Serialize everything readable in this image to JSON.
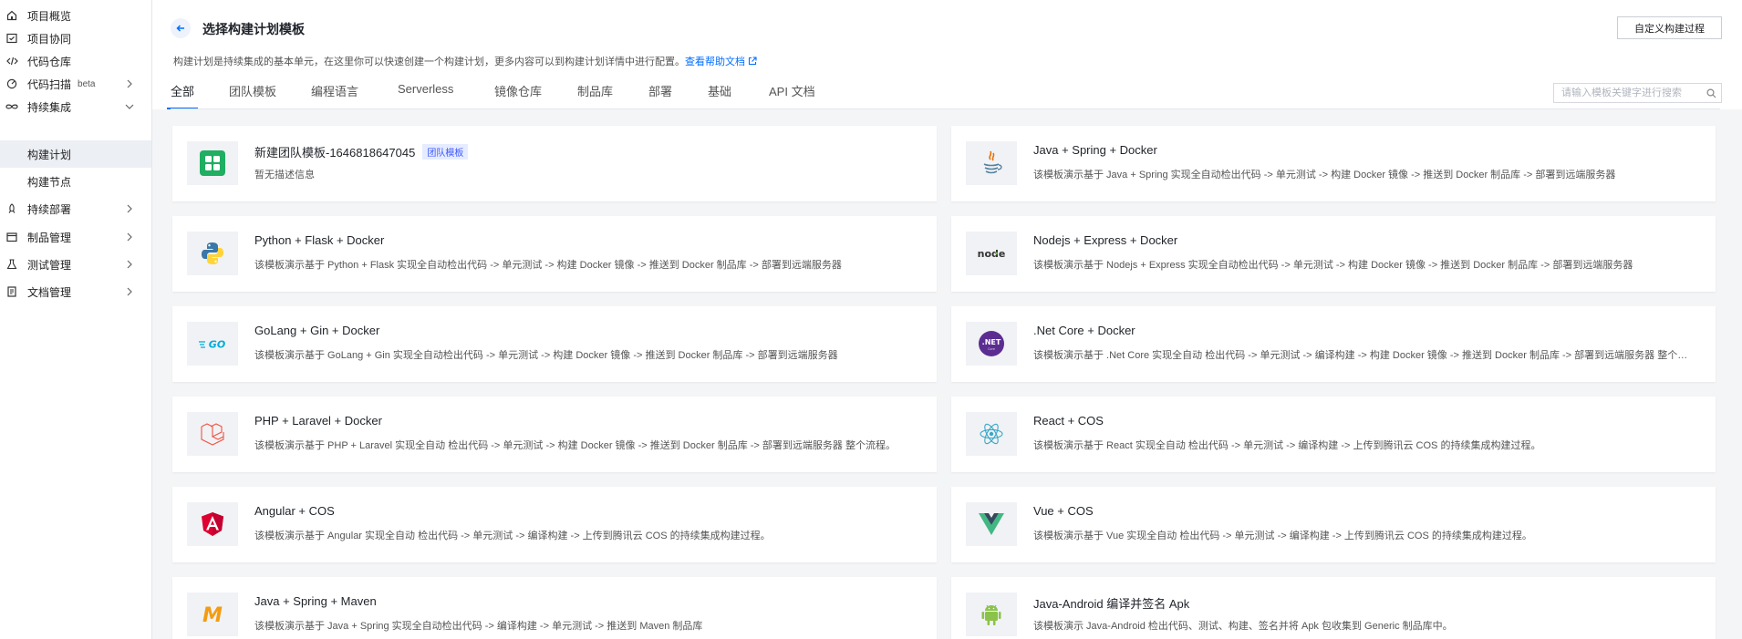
{
  "sidebar": {
    "items": [
      {
        "label": "项目概览",
        "icon": "home-icon"
      },
      {
        "label": "项目协同",
        "icon": "board-icon"
      },
      {
        "label": "代码仓库",
        "icon": "code-icon"
      },
      {
        "label": "代码扫描",
        "badge": "beta",
        "icon": "scan-icon"
      },
      {
        "label": "持续集成",
        "icon": "infinity-icon"
      },
      {
        "label": "构建计划"
      },
      {
        "label": "构建节点"
      },
      {
        "label": "持续部署",
        "icon": "rocket-icon"
      },
      {
        "label": "制品管理",
        "icon": "box-icon"
      },
      {
        "label": "测试管理",
        "icon": "flask-icon"
      },
      {
        "label": "文档管理",
        "icon": "doc-icon"
      }
    ]
  },
  "header": {
    "title": "选择构建计划模板",
    "custom_button": "自定义构建过程",
    "description": "构建计划是持续集成的基本单元，在这里你可以快速创建一个构建计划，更多内容可以到构建计划详情中进行配置。",
    "help_link": "查看帮助文档"
  },
  "tabs": [
    "全部",
    "团队模板",
    "编程语言",
    "Serverless",
    "镜像仓库",
    "制品库",
    "部署",
    "基础",
    "API 文档"
  ],
  "search": {
    "placeholder": "请输入模板关键字进行搜索"
  },
  "colors": {
    "accent": "#006eff",
    "tag_text": "#3d57ff",
    "tag_bg": "#e6ecff"
  },
  "templates": [
    {
      "name": "新建团队模板-1646818647045",
      "tag": "团队模板",
      "desc": "暂无描述信息",
      "icon": "team-template-icon"
    },
    {
      "name": "Java + Spring + Docker",
      "desc": "该模板演示基于 Java + Spring 实现全自动检出代码 -> 单元测试 -> 构建 Docker 镜像 -> 推送到 Docker 制品库 -> 部署到远端服务器",
      "icon": "java-icon"
    },
    {
      "name": "Python + Flask + Docker",
      "desc": "该模板演示基于 Python + Flask 实现全自动检出代码 -> 单元测试 -> 构建 Docker 镜像 -> 推送到 Docker 制品库 -> 部署到远端服务器",
      "icon": "python-icon"
    },
    {
      "name": "Nodejs + Express + Docker",
      "desc": "该模板演示基于 Nodejs + Express 实现全自动检出代码 -> 单元测试 -> 构建 Docker 镜像 -> 推送到 Docker 制品库 -> 部署到远端服务器",
      "icon": "node-icon"
    },
    {
      "name": "GoLang + Gin + Docker",
      "desc": "该模板演示基于 GoLang + Gin 实现全自动检出代码 -> 单元测试 -> 构建 Docker 镜像 -> 推送到 Docker 制品库 -> 部署到远端服务器",
      "icon": "golang-icon"
    },
    {
      "name": ".Net Core + Docker",
      "desc": "该模板演示基于 .Net Core 实现全自动 检出代码 -> 单元测试 -> 编译构建 -> 构建 Docker 镜像 -> 推送到 Docker 制品库 -> 部署到远端服务器 整个流程。",
      "icon": "dotnet-icon"
    },
    {
      "name": "PHP + Laravel + Docker",
      "desc": "该模板演示基于 PHP + Laravel 实现全自动 检出代码 -> 单元测试 -> 构建 Docker 镜像 -> 推送到 Docker 制品库 -> 部署到远端服务器 整个流程。",
      "icon": "laravel-icon"
    },
    {
      "name": "React + COS",
      "desc": "该模板演示基于 React 实现全自动 检出代码 -> 单元测试 -> 编译构建 -> 上传到腾讯云 COS 的持续集成构建过程。",
      "icon": "react-icon"
    },
    {
      "name": "Angular + COS",
      "desc": "该模板演示基于 Angular 实现全自动 检出代码 -> 单元测试 -> 编译构建 -> 上传到腾讯云 COS 的持续集成构建过程。",
      "icon": "angular-icon"
    },
    {
      "name": "Vue + COS",
      "desc": "该模板演示基于 Vue 实现全自动 检出代码 -> 单元测试 -> 编译构建 -> 上传到腾讯云 COS 的持续集成构建过程。",
      "icon": "vue-icon"
    },
    {
      "name": "Java + Spring + Maven",
      "desc": "该模板演示基于 Java + Spring 实现全自动检出代码 -> 编译构建 -> 单元测试 -> 推送到 Maven 制品库",
      "icon": "maven-icon"
    },
    {
      "name": "Java-Android 编译并签名 Apk",
      "desc": "该模板演示 Java-Android 检出代码、测试、构建、签名并将 Apk 包收集到 Generic 制品库中。",
      "icon": "android-icon"
    }
  ]
}
